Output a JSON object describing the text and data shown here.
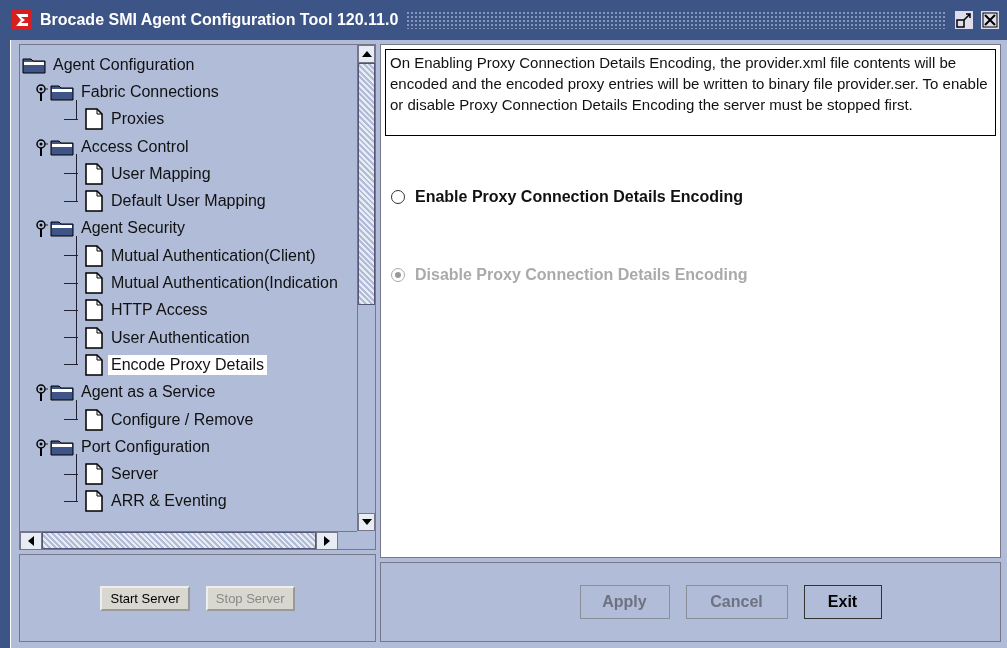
{
  "window": {
    "title": "Brocade SMI Agent Configuration Tool 120.11.0"
  },
  "tree": {
    "label": "Agent Configuration",
    "kind": "folder",
    "selected": false,
    "children": [
      {
        "label": "Fabric Connections",
        "kind": "folder",
        "expanded": true,
        "selected": false,
        "children": [
          {
            "label": "Proxies",
            "kind": "page",
            "selected": false
          }
        ]
      },
      {
        "label": "Access Control",
        "kind": "folder",
        "expanded": true,
        "selected": false,
        "children": [
          {
            "label": "User Mapping",
            "kind": "page",
            "selected": false
          },
          {
            "label": "Default User Mapping",
            "kind": "page",
            "selected": false
          }
        ]
      },
      {
        "label": "Agent Security",
        "kind": "folder",
        "expanded": true,
        "selected": false,
        "children": [
          {
            "label": "Mutual Authentication(Client)",
            "kind": "page",
            "selected": false
          },
          {
            "label": "Mutual Authentication(Indication",
            "kind": "page",
            "selected": false
          },
          {
            "label": "HTTP Access",
            "kind": "page",
            "selected": false
          },
          {
            "label": "User Authentication",
            "kind": "page",
            "selected": false
          },
          {
            "label": "Encode Proxy Details",
            "kind": "page",
            "selected": true
          }
        ]
      },
      {
        "label": "Agent as a Service",
        "kind": "folder",
        "expanded": true,
        "selected": false,
        "children": [
          {
            "label": "Configure / Remove",
            "kind": "page",
            "selected": false
          }
        ]
      },
      {
        "label": "Port Configuration",
        "kind": "folder",
        "expanded": true,
        "selected": false,
        "children": [
          {
            "label": "Server",
            "kind": "page",
            "selected": false
          },
          {
            "label": "ARR & Eventing",
            "kind": "page",
            "selected": false
          }
        ]
      }
    ]
  },
  "server_buttons": [
    {
      "label": "Start Server",
      "disabled": false
    },
    {
      "label": "Stop Server",
      "disabled": true
    }
  ],
  "description": "On Enabling Proxy Connection Details Encoding, the provider.xml file contents will be encoded and the encoded proxy entries will be written to binary file provider.ser. To enable or disable Proxy Connection Details Encoding the server must be stopped first.",
  "options": [
    {
      "label": "Enable Proxy Connection Details Encoding",
      "selected": false,
      "disabled": false
    },
    {
      "label": "Disable Proxy Connection Details Encoding",
      "selected": true,
      "disabled": true
    }
  ],
  "buttons": [
    {
      "label": "Apply",
      "disabled": true
    },
    {
      "label": "Cancel",
      "disabled": true
    },
    {
      "label": "Exit",
      "disabled": false
    }
  ]
}
